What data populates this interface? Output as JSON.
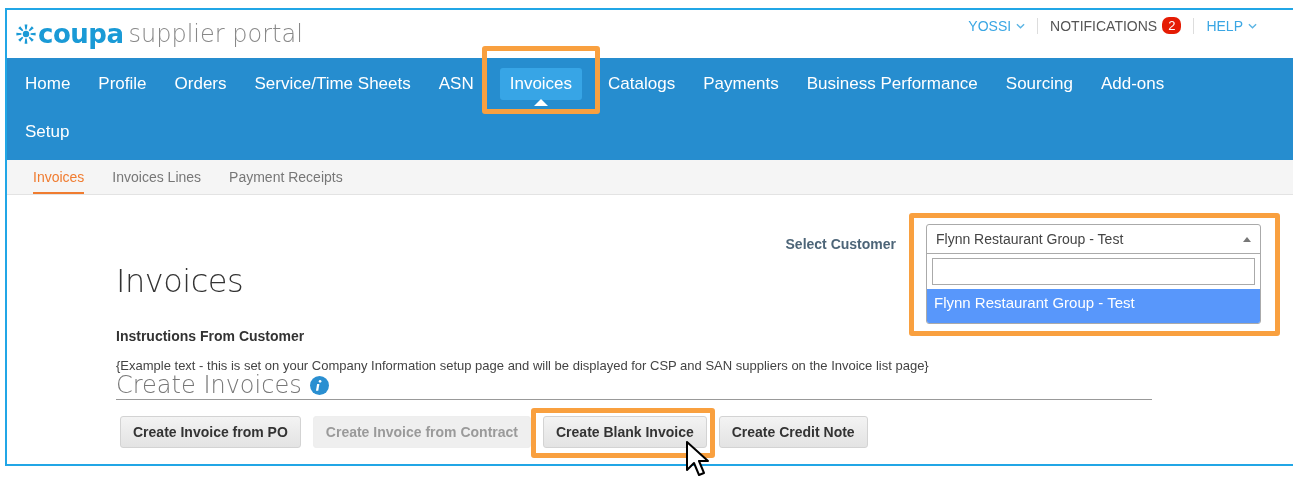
{
  "header": {
    "logo": {
      "brand": "coupa",
      "product": "supplier portal"
    },
    "user_menu": "YOSSI",
    "notifications": {
      "label": "NOTIFICATIONS",
      "count": "2"
    },
    "help_menu": "HELP"
  },
  "nav": [
    {
      "label": "Home",
      "selected": false,
      "highlighted": false
    },
    {
      "label": "Profile",
      "selected": false,
      "highlighted": false
    },
    {
      "label": "Orders",
      "selected": false,
      "highlighted": false
    },
    {
      "label": "Service/Time Sheets",
      "selected": false,
      "highlighted": false
    },
    {
      "label": "ASN",
      "selected": false,
      "highlighted": false
    },
    {
      "label": "Invoices",
      "selected": true,
      "highlighted": true
    },
    {
      "label": "Catalogs",
      "selected": false,
      "highlighted": false
    },
    {
      "label": "Payments",
      "selected": false,
      "highlighted": false
    },
    {
      "label": "Business Performance",
      "selected": false,
      "highlighted": false
    },
    {
      "label": "Sourcing",
      "selected": false,
      "highlighted": false
    },
    {
      "label": "Add-ons",
      "selected": false,
      "highlighted": false
    },
    {
      "label": "Setup",
      "selected": false,
      "highlighted": false
    }
  ],
  "subnav": [
    {
      "label": "Invoices",
      "selected": true
    },
    {
      "label": "Invoices Lines",
      "selected": false
    },
    {
      "label": "Payment Receipts",
      "selected": false
    }
  ],
  "customer_select": {
    "label": "Select Customer",
    "value": "Flynn Restaurant Group - Test",
    "expanded": true,
    "highlighted": true,
    "options": [
      {
        "label": "Flynn Restaurant Group - Test",
        "selected": true
      }
    ]
  },
  "page_title": "Invoices",
  "instructions": {
    "heading": "Instructions From Customer",
    "text": "{Example text - this is set on your Company Information setup page and will be displayed for CSP and SAN suppliers on the Invoice list page}"
  },
  "create_section": {
    "title": "Create Invoices",
    "buttons": [
      {
        "label": "Create Invoice from PO",
        "disabled": false,
        "highlighted": false
      },
      {
        "label": "Create Invoice from Contract",
        "disabled": true,
        "highlighted": false
      },
      {
        "label": "Create Blank Invoice",
        "disabled": false,
        "highlighted": true
      },
      {
        "label": "Create Credit Note",
        "disabled": false,
        "highlighted": false
      }
    ]
  }
}
